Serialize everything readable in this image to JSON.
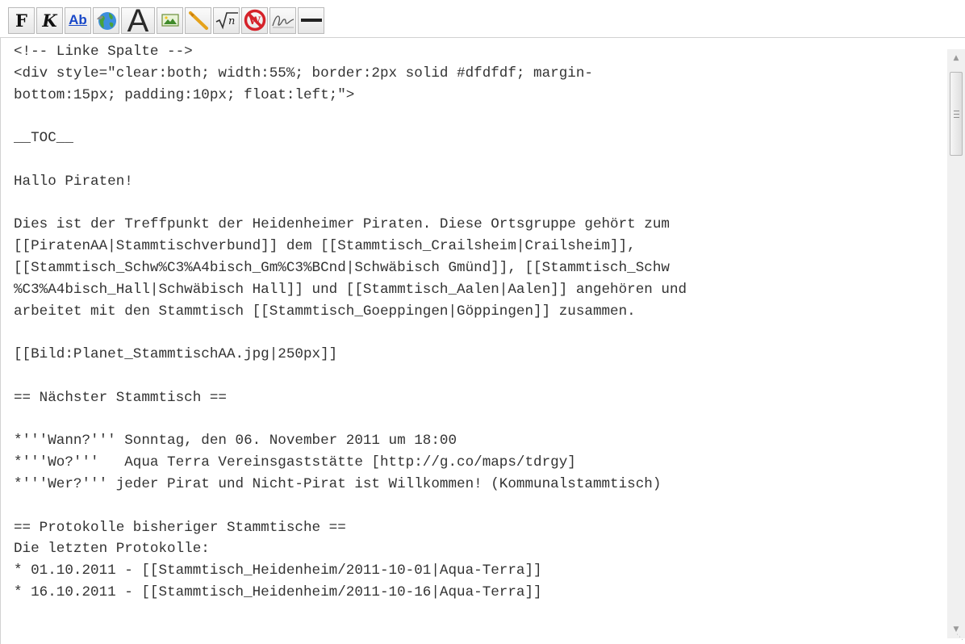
{
  "toolbar": {
    "bold_label": "F",
    "italic_label": "K",
    "internal_link_label": "Ab",
    "headline_label": "A"
  },
  "editor": {
    "lines": [
      "<!-- Linke Spalte -->",
      "<div style=\"clear:both; width:55%; border:2px solid #dfdfdf; margin-",
      "bottom:15px; padding:10px; float:left;\">",
      "",
      "__TOC__",
      "",
      "Hallo Piraten!",
      "",
      "Dies ist der Treffpunkt der Heidenheimer Piraten. Diese Ortsgruppe gehört zum",
      "[[PiratenAA|Stammtischverbund]] dem [[Stammtisch_Crailsheim|Crailsheim]],",
      "[[Stammtisch_Schw%C3%A4bisch_Gm%C3%BCnd|Schwäbisch Gmünd]], [[Stammtisch_Schw",
      "%C3%A4bisch_Hall|Schwäbisch Hall]] und [[Stammtisch_Aalen|Aalen]] angehören und",
      "arbeitet mit den Stammtisch [[Stammtisch_Goeppingen|Göppingen]] zusammen.",
      "",
      "[[Bild:Planet_StammtischAA.jpg|250px]]",
      "",
      "== Nächster Stammtisch ==",
      "",
      "*'''Wann?''' Sonntag, den 06. November 2011 um 18:00",
      "*'''Wo?'''   Aqua Terra Vereinsgaststätte [http://g.co/maps/tdrgy]",
      "*'''Wer?''' jeder Pirat und Nicht-Pirat ist Willkommen! (Kommunalstammtisch)",
      "",
      "== Protokolle bisheriger Stammtische ==",
      "Die letzten Protokolle:",
      "* 01.10.2011 - [[Stammtisch_Heidenheim/2011-10-01|Aqua-Terra]]",
      "* 16.10.2011 - [[Stammtisch_Heidenheim/2011-10-16|Aqua-Terra]]"
    ]
  },
  "scrollbar": {
    "position": 0.05
  }
}
